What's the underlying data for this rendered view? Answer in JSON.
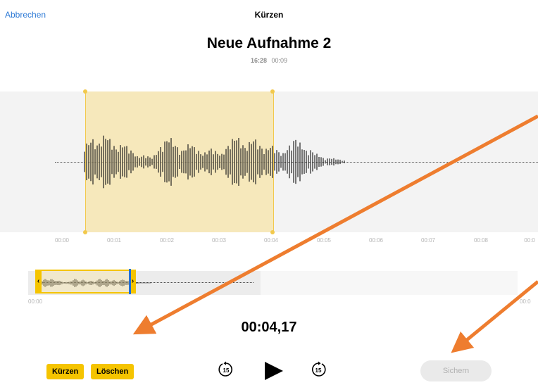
{
  "nav": {
    "cancel_label": "Abbrechen",
    "title": "Kürzen"
  },
  "recording": {
    "name": "Neue Aufnahme 2",
    "time": "16:28",
    "duration": "00:09"
  },
  "waveform": {
    "timeline_labels": [
      "00:00",
      "00:01",
      "00:02",
      "00:03",
      "00:04",
      "00:05",
      "00:06",
      "00:07",
      "00:08",
      "00:0"
    ]
  },
  "overview": {
    "start_label": "00:00",
    "end_label": "00:0"
  },
  "playback": {
    "position": "00:04,17"
  },
  "actions": {
    "trim_label": "Kürzen",
    "delete_label": "Löschen",
    "save_label": "Sichern"
  },
  "controls": {
    "skip_back_seconds": "15",
    "skip_forward_seconds": "15"
  },
  "colors": {
    "accent_yellow": "#f5c400",
    "selection_fill": "#f8e196",
    "link_blue": "#2f7bd6",
    "playhead_blue": "#1f6fd8",
    "annotation_arrow": "#ee7d2f"
  }
}
